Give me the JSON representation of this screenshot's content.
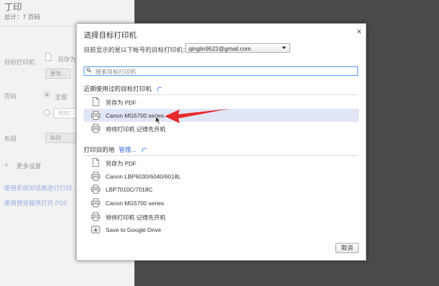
{
  "background": {
    "title": "丁印",
    "total": "总计：7 页码",
    "labels": {
      "destination": "目标打印机",
      "pages": "页码",
      "layout": "布局"
    },
    "save_as_partial": "另存为",
    "change_button": "更改...",
    "pages_all": "全部",
    "pages_example": "例如：1",
    "layout_value": "纵向",
    "more_settings": "更多设置",
    "system_dialog_link": "使用系统对话框进行打印...(⌥⌘",
    "open_pdf_link": "使用预览程序打开 PDF"
  },
  "dialog": {
    "title": "选择目标打印机",
    "close_glyph": "×",
    "account_label": "目前显示的是以下帐号的目标打印机：",
    "account_value": "qinglin9522@gmail.com",
    "search_placeholder": "搜索目标打印机",
    "recent_heading": "近期使用过的目标打印机",
    "recent": [
      {
        "label": "另存为 PDF",
        "icon": "document-icon"
      },
      {
        "label": "Canon MG5700 series",
        "icon": "printer-icon"
      },
      {
        "label": "帅帅打印机 记得先开机",
        "icon": "printer-icon"
      }
    ],
    "dest_heading": "打印目的地",
    "manage_link": "管理...",
    "destinations": [
      {
        "label": "另存为 PDF",
        "icon": "document-icon"
      },
      {
        "label": "Canon LBP6030/6040/6018L",
        "icon": "printer-icon"
      },
      {
        "label": "LBP7010C/7018C",
        "icon": "printer-icon"
      },
      {
        "label": "Canon MG5700 series",
        "icon": "printer-icon"
      },
      {
        "label": "帅帅打印机 记得先开机",
        "icon": "printer-icon"
      },
      {
        "label": "Save to Google Drive",
        "icon": "google-drive-icon"
      }
    ],
    "cancel_label": "取消"
  },
  "colors": {
    "accent": "#4d90fe",
    "selected_row": "#e1e6f6",
    "annotation_arrow": "#e8292a"
  }
}
